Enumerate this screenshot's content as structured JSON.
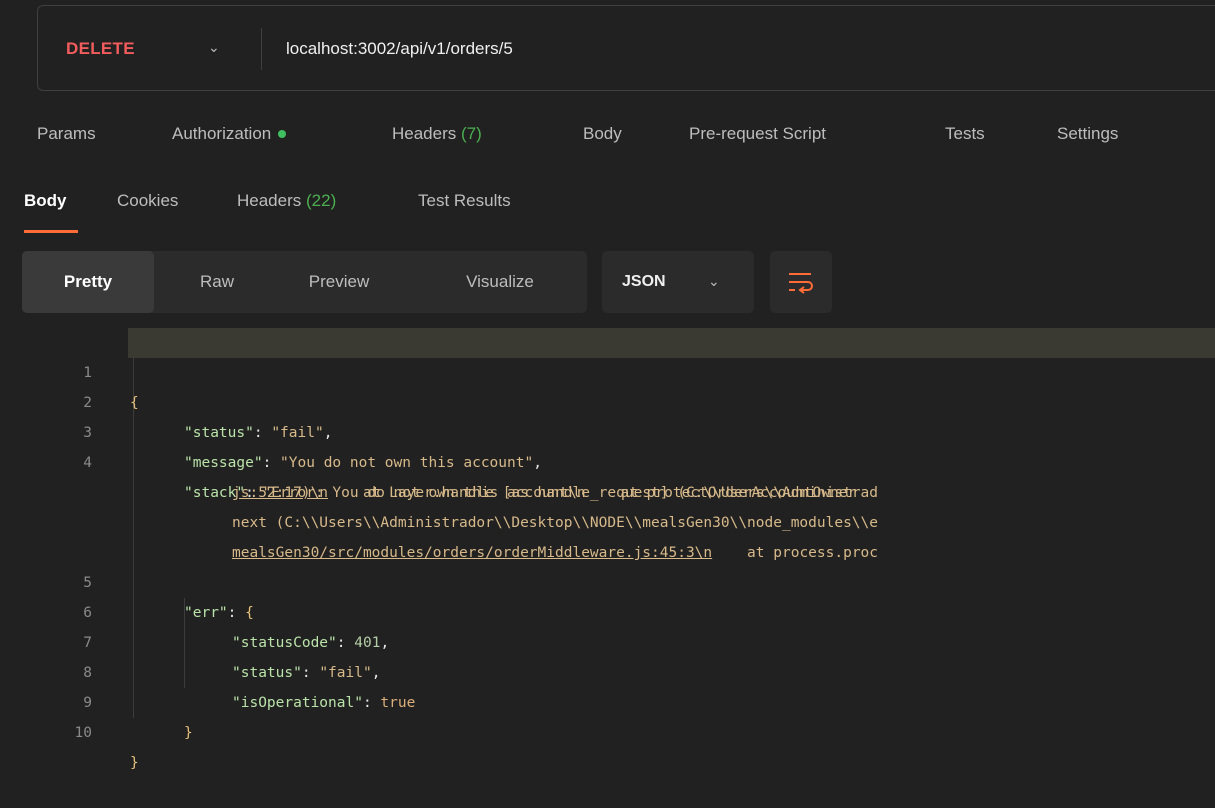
{
  "request": {
    "method": "DELETE",
    "url": "localhost:3002/api/v1/orders/5"
  },
  "request_tabs": {
    "params": "Params",
    "authorization": "Authorization",
    "headers": "Headers",
    "headers_count": "(7)",
    "body": "Body",
    "pre_request": "Pre-request Script",
    "tests": "Tests",
    "settings": "Settings"
  },
  "response_tabs": {
    "body": "Body",
    "cookies": "Cookies",
    "headers": "Headers",
    "headers_count": "(22)",
    "test_results": "Test Results"
  },
  "format": {
    "pretty": "Pretty",
    "raw": "Raw",
    "preview": "Preview",
    "visualize": "Visualize",
    "language": "JSON"
  },
  "code": {
    "line_numbers": [
      "1",
      "2",
      "3",
      "4",
      "5",
      "6",
      "7",
      "8",
      "9",
      "10"
    ],
    "open_brace": "{",
    "close_brace": "}",
    "status_key": "\"status\"",
    "status_val": "\"fail\"",
    "message_key": "\"message\"",
    "message_val": "\"You do not own this account\"",
    "stack_key": "\"stack\"",
    "stack_val_1": "\"Error: You do not own this account\\n    at protectOrderAccountOwner",
    "stack_val_2a": "js:52:17)\\n",
    "stack_val_2b": "    at Layer.handle [as handle_request] (C:\\\\Users\\\\Administrad",
    "stack_val_3": "next (C:\\\\Users\\\\Administrador\\\\Desktop\\\\NODE\\\\mealsGen30\\\\node_modules\\\\e",
    "stack_val_4a": "mealsGen30/src/modules/orders/orderMiddleware.js:45:3\\n",
    "stack_val_4b": "    at process.proc",
    "err_key": "\"err\"",
    "status_code_key": "\"statusCode\"",
    "status_code_val": "401",
    "err_status_key": "\"status\"",
    "err_status_val": "\"fail\"",
    "is_operational_key": "\"isOperational\"",
    "is_operational_val": "true",
    "inner_close": "}"
  },
  "colors": {
    "method": "#f25c5c",
    "accent": "#ff6c37",
    "count": "#4caf50",
    "auth_dot": "#3fbf5f"
  }
}
